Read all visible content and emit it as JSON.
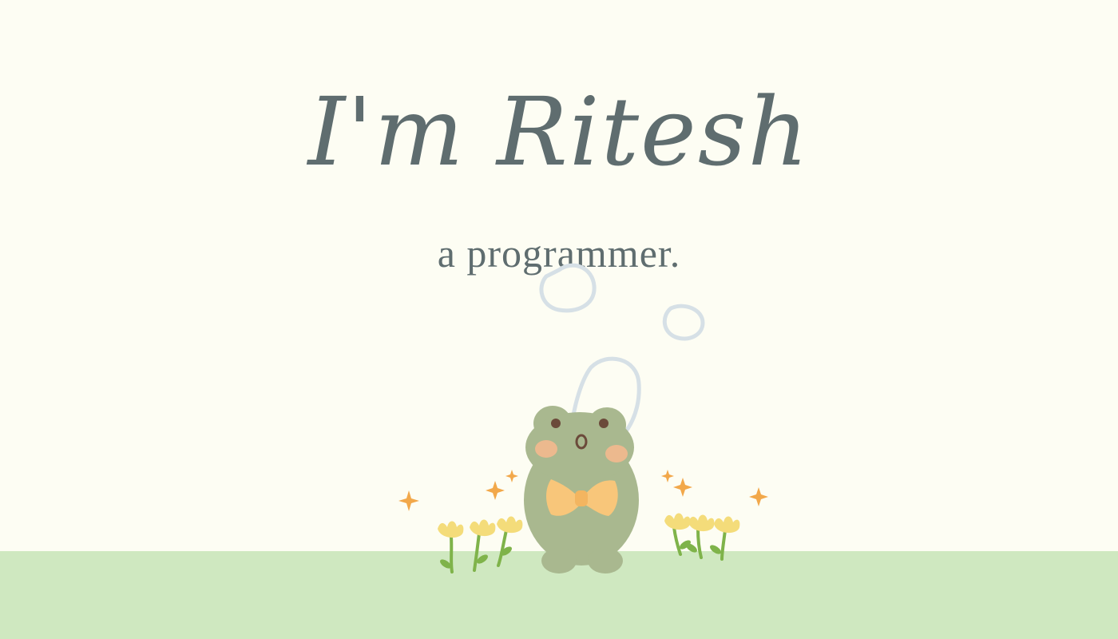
{
  "hero": {
    "title": "I'm Ritesh",
    "subtitle": "a programmer."
  },
  "colors": {
    "background": "#fdfdf3",
    "ground": "#cfe8c0",
    "text": "#5f6d6f",
    "frog": "#a9b88f",
    "bow": "#f8c67a",
    "flower": "#f4dc7a",
    "sparkle": "#f2a84a",
    "bubble": "#d6e0e6"
  },
  "illustration": {
    "character": "frog-icon",
    "items": [
      "bubble-icon",
      "flower-icon",
      "sparkle-icon"
    ]
  }
}
